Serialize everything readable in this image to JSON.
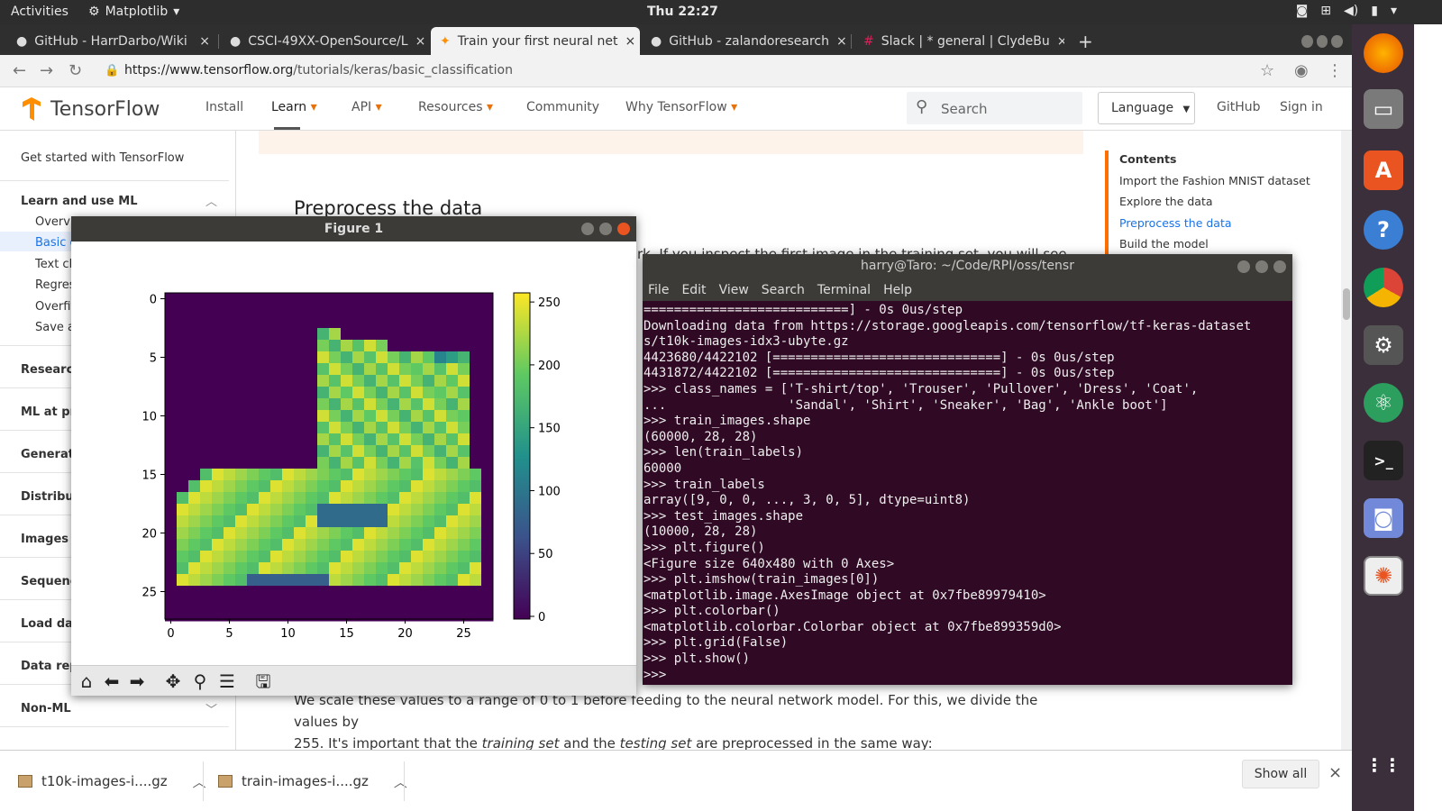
{
  "topbar": {
    "activities": "Activities",
    "app": "Matplotlib",
    "clock": "Thu 22:27"
  },
  "tabs": [
    {
      "label": "GitHub - HarrDarbo/Wiki"
    },
    {
      "label": "CSCI-49XX-OpenSource/L"
    },
    {
      "label": "Train your first neural net"
    },
    {
      "label": "GitHub - zalandoresearch"
    },
    {
      "label": "Slack | * general | ClydeBu"
    }
  ],
  "address": {
    "host": "https://www.tensorflow.org",
    "path": "/tutorials/keras/basic_classification"
  },
  "tf": {
    "brand": "TensorFlow",
    "nav": [
      "Install",
      "Learn",
      "API",
      "Resources",
      "Community",
      "Why TensorFlow"
    ],
    "search_placeholder": "Search",
    "language": "Language",
    "github": "GitHub",
    "signin": "Sign in"
  },
  "sidebar": {
    "get_started": "Get started with TensorFlow",
    "learn_use": "Learn and use ML",
    "sub": [
      "Overvie",
      "Basic c",
      "Text cla",
      "Regres",
      "Overfit",
      "Save ar"
    ],
    "sections": [
      "Research",
      "ML at pro",
      "Generativ",
      "Distribute",
      "Images",
      "Sequence",
      "Load data",
      "Data repr",
      "Non-ML"
    ]
  },
  "content": {
    "heading": "Preprocess the data",
    "partial": "rk. If you inspect the first image in the training set, you will see",
    "para1_a": "We scale these values to a range of 0 to 1 before feeding to the neural network model. For this, we divide the values by",
    "para1_b_pre": "255. It's important that the ",
    "para1_training": "training set",
    "para1_mid": " and the ",
    "para1_testing": "testing set",
    "para1_end": " are preprocessed in the same way:"
  },
  "toc": {
    "title": "Contents",
    "items": [
      "Import the Fashion MNIST dataset",
      "Explore the data",
      "Preprocess the data",
      "Build the model"
    ],
    "active_index": 2
  },
  "figure": {
    "title": "Figure 1",
    "xticks": [
      "0",
      "5",
      "10",
      "15",
      "20",
      "25"
    ],
    "yticks": [
      "0",
      "5",
      "10",
      "15",
      "20",
      "25"
    ],
    "cbar_ticks": [
      "250",
      "200",
      "150",
      "100",
      "50",
      "0"
    ],
    "colormap": "viridis"
  },
  "terminal": {
    "title": "harry@Taro: ~/Code/RPI/oss/tensr",
    "menu": [
      "File",
      "Edit",
      "View",
      "Search",
      "Terminal",
      "Help"
    ],
    "lines": [
      "===========================] - 0s 0us/step",
      "Downloading data from https://storage.googleapis.com/tensorflow/tf-keras-dataset",
      "s/t10k-images-idx3-ubyte.gz",
      "4423680/4422102 [==============================] - 0s 0us/step",
      "4431872/4422102 [==============================] - 0s 0us/step",
      ">>> class_names = ['T-shirt/top', 'Trouser', 'Pullover', 'Dress', 'Coat',",
      "...                'Sandal', 'Shirt', 'Sneaker', 'Bag', 'Ankle boot']",
      ">>> train_images.shape",
      "(60000, 28, 28)",
      ">>> len(train_labels)",
      "60000",
      ">>> train_labels",
      "array([9, 0, 0, ..., 3, 0, 5], dtype=uint8)",
      ">>> test_images.shape",
      "(10000, 28, 28)",
      ">>> plt.figure()",
      "<Figure size 640x480 with 0 Axes>",
      ">>> plt.imshow(train_images[0])",
      "<matplotlib.image.AxesImage object at 0x7fbe89979410>",
      ">>> plt.colorbar()",
      "<matplotlib.colorbar.Colorbar object at 0x7fbe899359d0>",
      ">>> plt.grid(False)",
      ">>> plt.show()"
    ]
  },
  "downloads": {
    "items": [
      "t10k-images-i....gz",
      "train-images-i....gz"
    ],
    "show_all": "Show all"
  }
}
